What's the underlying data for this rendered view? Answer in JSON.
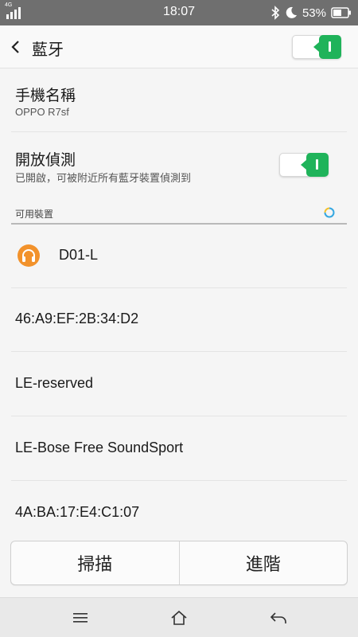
{
  "status": {
    "network": "4G",
    "time": "18:07",
    "battery": "53%",
    "icons": [
      "signal-icon",
      "bluetooth-icon",
      "moon-icon",
      "battery-icon"
    ]
  },
  "header": {
    "title": "藍牙",
    "back_icon": "chevron-left-icon",
    "bluetooth_enabled": true
  },
  "phone_name": {
    "label": "手機名稱",
    "value": "OPPO R7sf"
  },
  "discoverable": {
    "label": "開放偵測",
    "description": "已開啟，可被附近所有藍牙裝置偵測到",
    "enabled": true
  },
  "available": {
    "label": "可用裝置",
    "devices": [
      {
        "name": "D01-L",
        "icon": "headphones-icon"
      },
      {
        "name": "46:A9:EF:2B:34:D2"
      },
      {
        "name": "LE-reserved"
      },
      {
        "name": "LE-Bose Free SoundSport"
      },
      {
        "name": "4A:BA:17:E4:C1:07"
      }
    ]
  },
  "actions": {
    "scan": "掃描",
    "advanced": "進階"
  },
  "colors": {
    "accent_green": "#1fb35a",
    "headphone_orange": "#f2922b",
    "status_bar": "#6f6f6f"
  }
}
